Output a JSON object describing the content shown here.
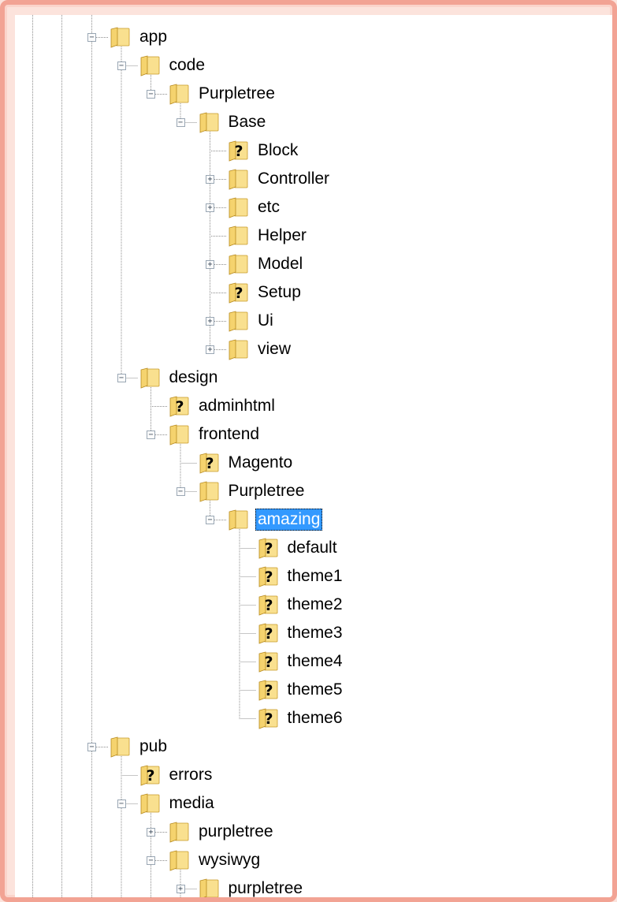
{
  "colors": {
    "frame_border": "#f2a394",
    "folder_light": "#f9e08f",
    "folder_dark": "#d8a82a",
    "selection": "#3399ff",
    "dotted_line": "#8c8c8c"
  },
  "tree": {
    "selected": "amazing",
    "nodes": [
      {
        "label": "app",
        "level": 0,
        "icon": "folder-icon",
        "toggle": "collapse"
      },
      {
        "label": "code",
        "level": 1,
        "icon": "folder-icon",
        "toggle": "collapse"
      },
      {
        "label": "Purpletree",
        "level": 2,
        "icon": "folder-icon",
        "toggle": "collapse"
      },
      {
        "label": "Base",
        "level": 3,
        "icon": "folder-icon",
        "toggle": "collapse"
      },
      {
        "label": "Block",
        "level": 4,
        "icon": "unknown-folder-icon",
        "toggle": "none"
      },
      {
        "label": "Controller",
        "level": 4,
        "icon": "folder-icon",
        "toggle": "expand"
      },
      {
        "label": "etc",
        "level": 4,
        "icon": "folder-icon",
        "toggle": "expand"
      },
      {
        "label": "Helper",
        "level": 4,
        "icon": "folder-icon",
        "toggle": "none"
      },
      {
        "label": "Model",
        "level": 4,
        "icon": "folder-icon",
        "toggle": "expand"
      },
      {
        "label": "Setup",
        "level": 4,
        "icon": "unknown-folder-icon",
        "toggle": "none"
      },
      {
        "label": "Ui",
        "level": 4,
        "icon": "folder-icon",
        "toggle": "expand"
      },
      {
        "label": "view",
        "level": 4,
        "icon": "folder-icon",
        "toggle": "expand"
      },
      {
        "label": "design",
        "level": 1,
        "icon": "folder-icon",
        "toggle": "collapse"
      },
      {
        "label": "adminhtml",
        "level": 2,
        "icon": "unknown-folder-icon",
        "toggle": "none"
      },
      {
        "label": "frontend",
        "level": 2,
        "icon": "folder-icon",
        "toggle": "collapse"
      },
      {
        "label": "Magento",
        "level": 3,
        "icon": "unknown-folder-icon",
        "toggle": "none"
      },
      {
        "label": "Purpletree",
        "level": 3,
        "icon": "folder-icon",
        "toggle": "collapse"
      },
      {
        "label": "amazing",
        "level": 4,
        "icon": "folder-icon",
        "toggle": "collapse",
        "selected": true
      },
      {
        "label": "default",
        "level": 5,
        "icon": "unknown-folder-icon",
        "toggle": "none"
      },
      {
        "label": "theme1",
        "level": 5,
        "icon": "unknown-folder-icon",
        "toggle": "none"
      },
      {
        "label": "theme2",
        "level": 5,
        "icon": "unknown-folder-icon",
        "toggle": "none"
      },
      {
        "label": "theme3",
        "level": 5,
        "icon": "unknown-folder-icon",
        "toggle": "none"
      },
      {
        "label": "theme4",
        "level": 5,
        "icon": "unknown-folder-icon",
        "toggle": "none"
      },
      {
        "label": "theme5",
        "level": 5,
        "icon": "unknown-folder-icon",
        "toggle": "none"
      },
      {
        "label": "theme6",
        "level": 5,
        "icon": "unknown-folder-icon",
        "toggle": "none"
      },
      {
        "label": "pub",
        "level": 0,
        "icon": "folder-icon",
        "toggle": "collapse"
      },
      {
        "label": "errors",
        "level": 1,
        "icon": "unknown-folder-icon",
        "toggle": "none"
      },
      {
        "label": "media",
        "level": 1,
        "icon": "folder-icon",
        "toggle": "collapse"
      },
      {
        "label": "purpletree",
        "level": 2,
        "icon": "folder-icon",
        "toggle": "expand"
      },
      {
        "label": "wysiwyg",
        "level": 2,
        "icon": "folder-icon",
        "toggle": "collapse"
      },
      {
        "label": "purpletree",
        "level": 3,
        "icon": "folder-icon",
        "toggle": "expand"
      }
    ]
  }
}
